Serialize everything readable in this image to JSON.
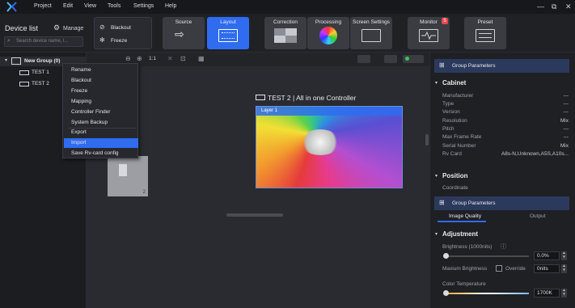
{
  "menubar": {
    "items": [
      "Project",
      "Edit",
      "View",
      "Tools",
      "Settings",
      "Help"
    ],
    "window_controls": [
      "—",
      "⧉",
      "✕"
    ]
  },
  "toolbar": {
    "blackout_label": "Blackout",
    "freeze_label": "Freeze",
    "tabs": [
      {
        "label": "Source"
      },
      {
        "label": "Layout"
      },
      {
        "label": "Correction"
      },
      {
        "label": "Processing"
      },
      {
        "label": "Screen Settings"
      },
      {
        "label": "Monitor"
      },
      {
        "label": "Preset"
      }
    ],
    "monitor_badge": "5"
  },
  "left_panel": {
    "title": "Device list",
    "manage_label": "Manage",
    "search_placeholder": "Search device name, l...",
    "group_label": "New Group (0)",
    "devices": [
      "TEST 1",
      "TEST 2"
    ]
  },
  "context_menu": {
    "items": [
      "Rename",
      "Blackout",
      "Freeze",
      "Mapping",
      "Controller Finder",
      "System Backup",
      "Export",
      "Import",
      "Save Rv-card config"
    ],
    "highlighted": "Import"
  },
  "canvas": {
    "zoom_label": "1:1",
    "screen_title": "TEST 2 | All in one Controller",
    "layer_label": "Layer 1",
    "small_box_number": "2"
  },
  "right_panel": {
    "group_params_label": "Group Parameters",
    "cabinet": {
      "title": "Cabinet",
      "rows": [
        {
          "label": "Manufacturer",
          "value": "---"
        },
        {
          "label": "Type",
          "value": "---"
        },
        {
          "label": "Version",
          "value": "---"
        },
        {
          "label": "Resolution",
          "value": "Mix"
        },
        {
          "label": "Pitch",
          "value": "---"
        },
        {
          "label": "Max Frame Rate",
          "value": "---"
        },
        {
          "label": "Serial Number",
          "value": "Mix"
        },
        {
          "label": "Rv Card",
          "value": "A8s-N,Unknown,A5S,A10s..."
        }
      ]
    },
    "position": {
      "title": "Position",
      "coordinate_label": "Coordinate"
    },
    "group_params_label_2": "Group Parameters",
    "tabs": [
      "Image Quality",
      "Output"
    ],
    "adjustment": {
      "title": "Adjustment",
      "brightness_label": "Brightness  (1000nits)",
      "brightness_value": "0.0%",
      "brightness_level": 0,
      "max_brightness_label": "Maxium Brightness",
      "override_label": "Override",
      "max_brightness_value": "0nits",
      "color_temp_label": "Color Temperature",
      "color_temp_value": "1700K",
      "color_temp_level": 0
    }
  }
}
